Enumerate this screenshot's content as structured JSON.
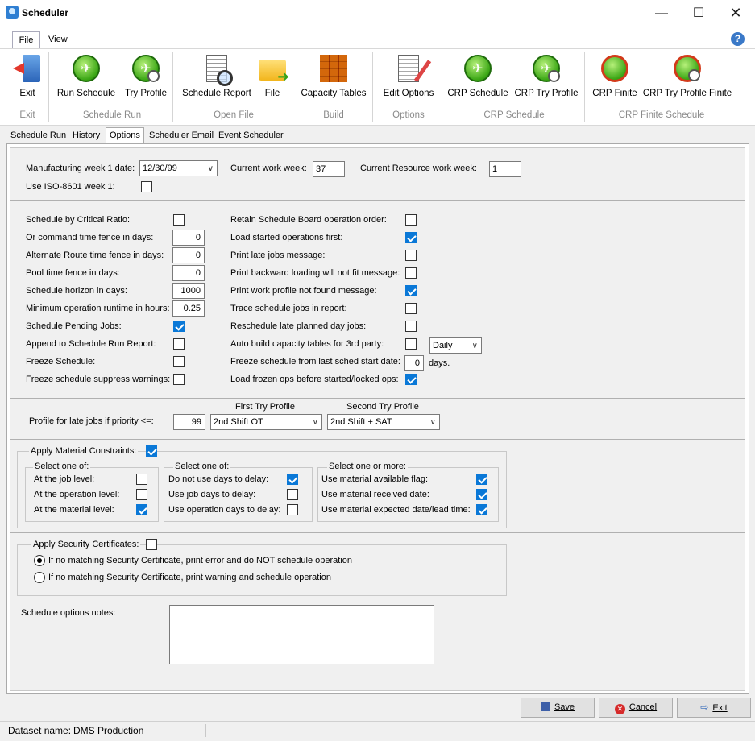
{
  "window": {
    "title": "Scheduler"
  },
  "menu": {
    "file": "File",
    "view": "View"
  },
  "ribbon": {
    "buttons": {
      "exit": "Exit",
      "run_schedule": "Run Schedule",
      "try_profile": "Try Profile",
      "schedule_report": "Schedule Report",
      "file": "File",
      "capacity_tables": "Capacity Tables",
      "edit_options": "Edit Options",
      "crp_schedule": "CRP Schedule",
      "crp_try_profile": "CRP Try Profile",
      "crp_finite": "CRP Finite",
      "crp_try_profile_finite": "CRP Try Profile Finite"
    },
    "groups": {
      "exit": "Exit",
      "schedule_run": "Schedule Run",
      "open_file": "Open File",
      "build": "Build",
      "options": "Options",
      "crp_schedule": "CRP Schedule",
      "crp_finite_schedule": "CRP Finite Schedule"
    }
  },
  "tabs": [
    "Schedule Run",
    "History",
    "Options",
    "Scheduler Email",
    "Event Scheduler"
  ],
  "options": {
    "mfg_week_label": "Manufacturing week 1 date:",
    "mfg_week_value": "12/30/99",
    "current_work_week_label": "Current work week:",
    "current_work_week_value": "37",
    "current_resource_week_label": "Current Resource work week:",
    "current_resource_week_value": "1",
    "iso_label": "Use ISO-8601 week 1:",
    "left": [
      {
        "label": "Schedule by Critical Ratio:",
        "type": "check",
        "checked": false
      },
      {
        "label": "Or command time fence in days:",
        "type": "num",
        "value": "0"
      },
      {
        "label": "Alternate Route time fence in days:",
        "type": "num",
        "value": "0"
      },
      {
        "label": "Pool time fence in days:",
        "type": "num",
        "value": "0"
      },
      {
        "label": "Schedule horizon in days:",
        "type": "num",
        "value": "1000"
      },
      {
        "label": "Minimum operation runtime in hours:",
        "type": "num",
        "value": "0.25"
      },
      {
        "label": "Schedule Pending Jobs:",
        "type": "check",
        "checked": true
      },
      {
        "label": "Append to Schedule Run Report:",
        "type": "check",
        "checked": false
      },
      {
        "label": "Freeze Schedule:",
        "type": "check",
        "checked": false
      },
      {
        "label": "Freeze schedule suppress warnings:",
        "type": "check",
        "checked": false
      }
    ],
    "right": [
      {
        "label": "Retain Schedule Board operation order:",
        "checked": false
      },
      {
        "label": "Load started operations first:",
        "checked": true
      },
      {
        "label": "Print late jobs message:",
        "checked": false
      },
      {
        "label": "Print backward loading will not fit message:",
        "checked": false
      },
      {
        "label": "Print work profile not found message:",
        "checked": true
      },
      {
        "label": "Trace schedule jobs in report:",
        "checked": false
      },
      {
        "label": "Reschedule late planned day jobs:",
        "checked": false
      },
      {
        "label": "Auto build capacity tables for 3rd party:",
        "checked": false
      },
      {
        "label": "Freeze schedule from last sched start date:",
        "checked": null
      },
      {
        "label": "Load frozen ops before started/locked ops:",
        "checked": true
      }
    ],
    "auto_build_freq": "Daily",
    "freeze_days_value": "0",
    "freeze_days_unit": "days.",
    "first_try_profile_label": "First Try Profile",
    "second_try_profile_label": "Second Try Profile",
    "late_jobs_label": "Profile for late jobs if priority <=:",
    "late_jobs_priority": "99",
    "first_try_profile_value": "2nd Shift OT",
    "second_try_profile_value": "2nd Shift + SAT",
    "material": {
      "label": "Apply Material Constraints:",
      "group1_title": "Select one of:",
      "group1": [
        {
          "label": "At the job level:",
          "checked": false
        },
        {
          "label": "At the operation level:",
          "checked": false
        },
        {
          "label": "At the material level:",
          "checked": true
        }
      ],
      "group2_title": "Select one of:",
      "group2": [
        {
          "label": "Do not use days to delay:",
          "checked": true
        },
        {
          "label": "Use job days to delay:",
          "checked": false
        },
        {
          "label": "Use operation days to delay:",
          "checked": false
        }
      ],
      "group3_title": "Select one or more:",
      "group3": [
        {
          "label": "Use material available flag:",
          "checked": true
        },
        {
          "label": "Use material received date:",
          "checked": true
        },
        {
          "label": "Use material expected date/lead time:",
          "checked": true
        }
      ]
    },
    "security": {
      "label": "Apply Security Certificates:",
      "opt1": "If no matching Security Certificate, print error and do NOT schedule operation",
      "opt2": "If no matching Security Certificate, print warning and schedule operation"
    },
    "notes_label": "Schedule options notes:"
  },
  "buttons": {
    "save": "Save",
    "cancel": "Cancel",
    "exit": "Exit"
  },
  "status": {
    "dataset_label": "Dataset name:",
    "dataset_value": "DMS Production"
  }
}
